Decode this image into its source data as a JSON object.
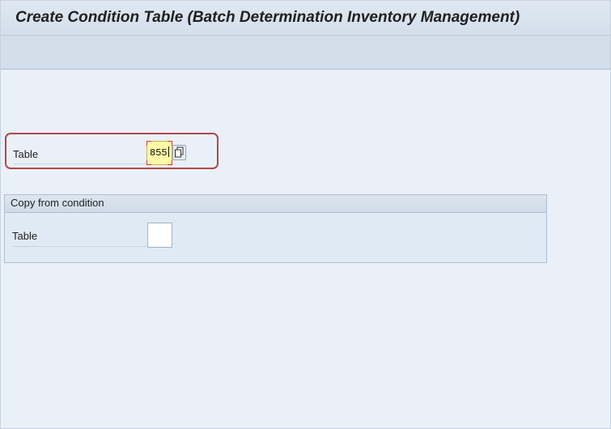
{
  "header": {
    "title": "Create Condition Table (Batch Determination Inventory Management)"
  },
  "form": {
    "table_label": "Table",
    "table_value": "855",
    "f4_icon": "copy-icon"
  },
  "copy_group": {
    "title": "Copy from condition",
    "table_label": "Table",
    "table_value": ""
  },
  "colors": {
    "highlight_border": "#b2474a",
    "active_input_bg": "#fff9a8",
    "header_bg": "#d3dfeb"
  }
}
